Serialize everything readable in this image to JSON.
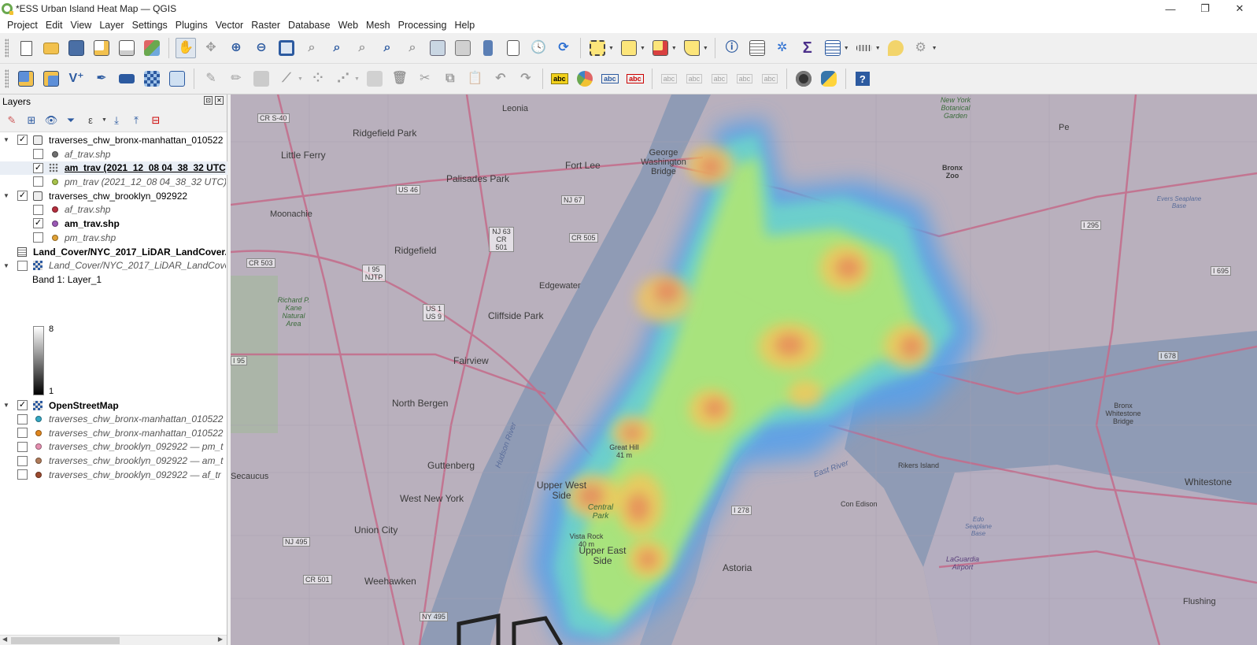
{
  "window": {
    "title": "*ESS Urban Island Heat Map — QGIS",
    "minimize": "—",
    "maximize": "❐",
    "close": "✕"
  },
  "menubar": [
    "Project",
    "Edit",
    "View",
    "Layer",
    "Settings",
    "Plugins",
    "Vector",
    "Raster",
    "Database",
    "Web",
    "Mesh",
    "Processing",
    "Help"
  ],
  "layers_panel": {
    "title": "Layers",
    "float_button": "⊡",
    "close_button": "✕",
    "tree": [
      {
        "kind": "group",
        "name": "traverses_chw_bronx-manhattan_010522",
        "checked": true,
        "expanded": true
      },
      {
        "kind": "layer",
        "name": "af_trav.shp",
        "checked": false,
        "style": "italic",
        "color": "#707070"
      },
      {
        "kind": "layer",
        "name": "am_trav (2021_12_08 04_38_32 UTC).s",
        "checked": true,
        "style": "bold",
        "color": "heatmap",
        "selected": true
      },
      {
        "kind": "layer",
        "name": "pm_trav (2021_12_08 04_38_32 UTC).s",
        "checked": false,
        "style": "italic",
        "color": "#a7c24b"
      },
      {
        "kind": "group",
        "name": "traverses_chw_brooklyn_092922",
        "checked": true,
        "expanded": true
      },
      {
        "kind": "layer",
        "name": "af_trav.shp",
        "checked": false,
        "style": "italic",
        "color": "#b52e3e"
      },
      {
        "kind": "layer",
        "name": "am_trav.shp",
        "checked": true,
        "style": "bold",
        "color": "#9b59b6"
      },
      {
        "kind": "layer",
        "name": "pm_trav.shp",
        "checked": false,
        "style": "italic",
        "color": "#e0a136"
      },
      {
        "kind": "raster",
        "name": "Land_Cover/NYC_2017_LiDAR_LandCover.img"
      },
      {
        "kind": "raster-layer",
        "name": "Land_Cover/NYC_2017_LiDAR_LandCover",
        "checked": false,
        "style": "italic",
        "expanded": true
      },
      {
        "kind": "band",
        "name": "Band 1: Layer_1",
        "max": "8",
        "min": "1"
      },
      {
        "kind": "basemap",
        "name": "OpenStreetMap",
        "checked": true,
        "style": "bold",
        "expanded": true
      },
      {
        "kind": "layer",
        "name": "traverses_chw_bronx-manhattan_010522",
        "checked": false,
        "style": "italic",
        "color": "#35a8c4"
      },
      {
        "kind": "layer",
        "name": "traverses_chw_bronx-manhattan_010522",
        "checked": false,
        "style": "italic",
        "color": "#e0861e"
      },
      {
        "kind": "layer",
        "name": "traverses_chw_brooklyn_092922 — pm_t",
        "checked": false,
        "style": "italic",
        "color": "#e58fb0"
      },
      {
        "kind": "layer",
        "name": "traverses_chw_brooklyn_092922 — am_t",
        "checked": false,
        "style": "italic",
        "color": "#b07b5a"
      },
      {
        "kind": "layer",
        "name": "traverses_chw_brooklyn_092922 — af_tr",
        "checked": false,
        "style": "italic",
        "color": "#9c4a2f"
      }
    ]
  },
  "toolbar1_icons": [
    "new-project",
    "open-project",
    "save-project",
    "save-as",
    "print-layout",
    "style-manager",
    "pan",
    "pan-to-selection",
    "zoom-in",
    "zoom-out",
    "zoom-full",
    "zoom-selection",
    "zoom-layer",
    "zoom-native",
    "zoom-last",
    "zoom-next",
    "new-bookmark",
    "show-bookmarks",
    "spatial-bookmark",
    "temporal-controller",
    "refresh",
    "select-features",
    "attribute-table-select",
    "deselect",
    "add-annotation",
    "identify",
    "open-field-calculator",
    "settings",
    "statistics",
    "attribute-table",
    "measure",
    "map-tips",
    "locator"
  ],
  "toolbar2_icons": [
    "data-source-manager",
    "new-geopackage",
    "new-shapefile",
    "digitize",
    "new-virtual-layer",
    "new-raster",
    "new-mesh",
    "current-edits",
    "toggle-editing",
    "save-edits",
    "digitize-shape",
    "vertex-tool",
    "feature-tool",
    "multi-edit",
    "delete-selected",
    "cut",
    "copy",
    "paste",
    "undo",
    "redo",
    "label",
    "diagram",
    "highlight-labels",
    "pin-labels",
    "show-labels",
    "move-labels",
    "rotate-labels",
    "change-labels",
    "labels-toolbar",
    "processing-toolbox",
    "python-console",
    "help"
  ],
  "toolbar_labels": {
    "label_tool": "abc",
    "help": "?"
  },
  "map": {
    "basemap": "OpenStreetMap",
    "heatmap_layer": "am_trav (2021_12_08 04_38_32 UTC)",
    "labels": {
      "leonia": "Leonia",
      "ridgefield_park": "Ridgefield Park",
      "little_ferry": "Little Ferry",
      "fort_lee": "Fort Lee",
      "gwb": "George Washington Bridge",
      "palisades_park": "Palisades Park",
      "moonachie": "Moonachie",
      "ridgefield": "Ridgefield",
      "edgewater": "Edgewater",
      "cliffside_park": "Cliffside Park",
      "fairview": "Fairview",
      "north_bergen": "North Bergen",
      "guttenberg": "Guttenberg",
      "west_new_york": "West New York",
      "union_city": "Union City",
      "weehawken": "Weehawken",
      "secaucus": "Secaucus",
      "upper_west_side": "Upper West Side",
      "central_park": "Central Park",
      "upper_east_side": "Upper East Side",
      "great_hill": "Great Hill 41 m",
      "vista_rock": "Vista Rock 40 m",
      "astoria": "Astoria",
      "bronx_zoo": "Bronx Zoo",
      "ny_botanical": "New York Botanical Garden",
      "rikers_island": "Rikers Island",
      "bronx_whitestone": "Bronx Whitestone Bridge",
      "whitestone": "Whitestone",
      "flushing": "Flushing",
      "laguardia": "LaGuardia Airport",
      "con_edison": "Con Edison",
      "evers_seaplane": "Evers Seaplane Base",
      "edo_seaplane": "Edo Seaplane Base",
      "richard_kane": "Richard P. Kane Natural Area",
      "hudson_river": "Hudson River",
      "east_river": "East River",
      "pe": "Pe"
    },
    "shields": [
      "CR S-40",
      "US 46",
      "NJ 67",
      "NJ 63 CR 501",
      "CR 505",
      "I 95 NJTP",
      "US 1 US 9",
      "CR 503",
      "I 95",
      "NJ 495",
      "CR 501",
      "NY 495",
      "I 278",
      "I 695",
      "I 678",
      "I 295"
    ]
  }
}
